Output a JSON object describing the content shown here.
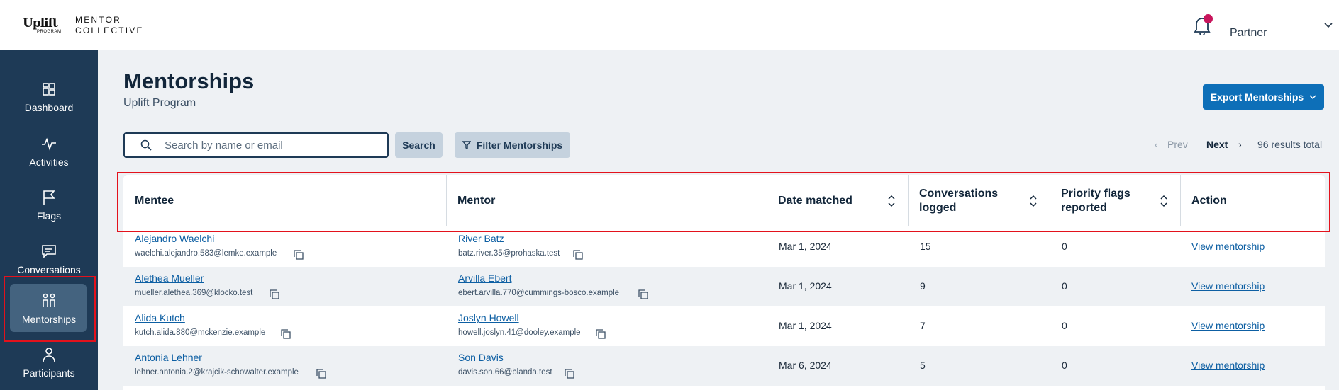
{
  "header": {
    "logo_primary": "Uplift",
    "logo_program": "PROGRAM",
    "logo_mc_line1": "MENTOR",
    "logo_mc_line2": "COLLECTIVE",
    "user_label": "Partner",
    "notification_dot_color": "#c8165c"
  },
  "sidebar": {
    "items": [
      {
        "label": "Dashboard",
        "icon": "dashboard-icon"
      },
      {
        "label": "Activities",
        "icon": "activity-icon"
      },
      {
        "label": "Flags",
        "icon": "flag-icon"
      },
      {
        "label": "Conversations",
        "icon": "chat-icon"
      },
      {
        "label": "Mentorships",
        "icon": "people-icon",
        "active": true
      },
      {
        "label": "Participants",
        "icon": "person-icon"
      }
    ]
  },
  "page": {
    "title": "Mentorships",
    "subtitle": "Uplift Program",
    "export_label": "Export Mentorships"
  },
  "toolbar": {
    "search_placeholder": "Search by name or email",
    "search_label": "Search",
    "filter_label": "Filter Mentorships",
    "prev_label": "Prev",
    "next_label": "Next",
    "results_label": "96 results total"
  },
  "table": {
    "columns": [
      "Mentee",
      "Mentor",
      "Date matched",
      "Conversations logged",
      "Priority flags reported",
      "Action"
    ],
    "rows": [
      {
        "mentee": "Alejandro Waelchi",
        "mentee_email": "waelchi.alejandro.583@lemke.example",
        "mentor": "River Batz",
        "mentor_email": "batz.river.35@prohaska.test",
        "date": "Mar 1, 2024",
        "conversations": "15",
        "flags": "0",
        "action": "View mentorship"
      },
      {
        "mentee": "Alethea Mueller",
        "mentee_email": "mueller.alethea.369@klocko.test",
        "mentor": "Arvilla Ebert",
        "mentor_email": "ebert.arvilla.770@cummings-bosco.example",
        "date": "Mar 1, 2024",
        "conversations": "9",
        "flags": "0",
        "action": "View mentorship"
      },
      {
        "mentee": "Alida Kutch",
        "mentee_email": "kutch.alida.880@mckenzie.example",
        "mentor": "Joslyn Howell",
        "mentor_email": "howell.joslyn.41@dooley.example",
        "date": "Mar 1, 2024",
        "conversations": "7",
        "flags": "0",
        "action": "View mentorship"
      },
      {
        "mentee": "Antonia Lehner",
        "mentee_email": "lehner.antonia.2@krajcik-schowalter.example",
        "mentor": "Son Davis",
        "mentor_email": "davis.son.66@blanda.test",
        "date": "Mar 6, 2024",
        "conversations": "5",
        "flags": "0",
        "action": "View mentorship"
      }
    ]
  }
}
